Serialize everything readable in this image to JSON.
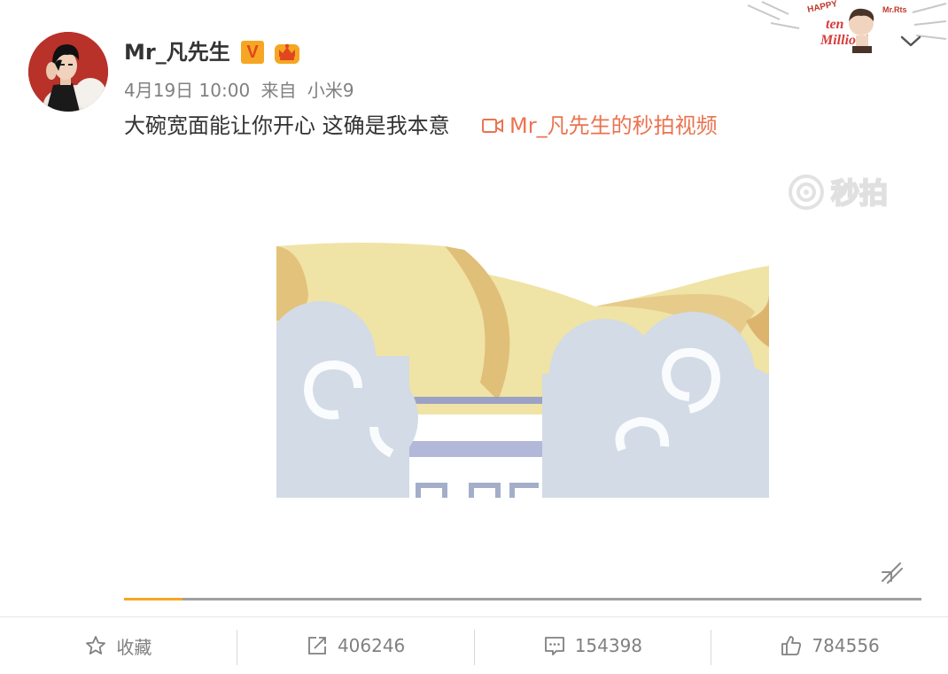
{
  "post": {
    "username": "Mr_凡先生",
    "verified_badge": "V",
    "meta": {
      "date": "4月19日 10:00",
      "source_prefix": "来自",
      "source_device": "小米9"
    },
    "text": "大碗宽面能让你开心 这确是我本意",
    "video_link_label": "Mr_凡先生的秒拍视频",
    "watermark_text": "秒拍",
    "video_progress_fraction": 0.073
  },
  "sticker": {
    "happy": "HAPPY",
    "name": "Mr.Rts",
    "line1": "ten",
    "line2": "Million!"
  },
  "actions": {
    "favorite_label": "收藏",
    "repost_count": "406246",
    "comment_count": "154398",
    "like_count": "784556"
  },
  "colors": {
    "link": "#eb7350",
    "progress": "#f5a623",
    "muted": "#808080"
  },
  "icons": {
    "favorite": "star-icon",
    "repost": "repost-icon",
    "comment": "comment-icon",
    "like": "thumbs-up-icon",
    "video": "video-camera-icon",
    "expand": "chevron-down-icon"
  }
}
